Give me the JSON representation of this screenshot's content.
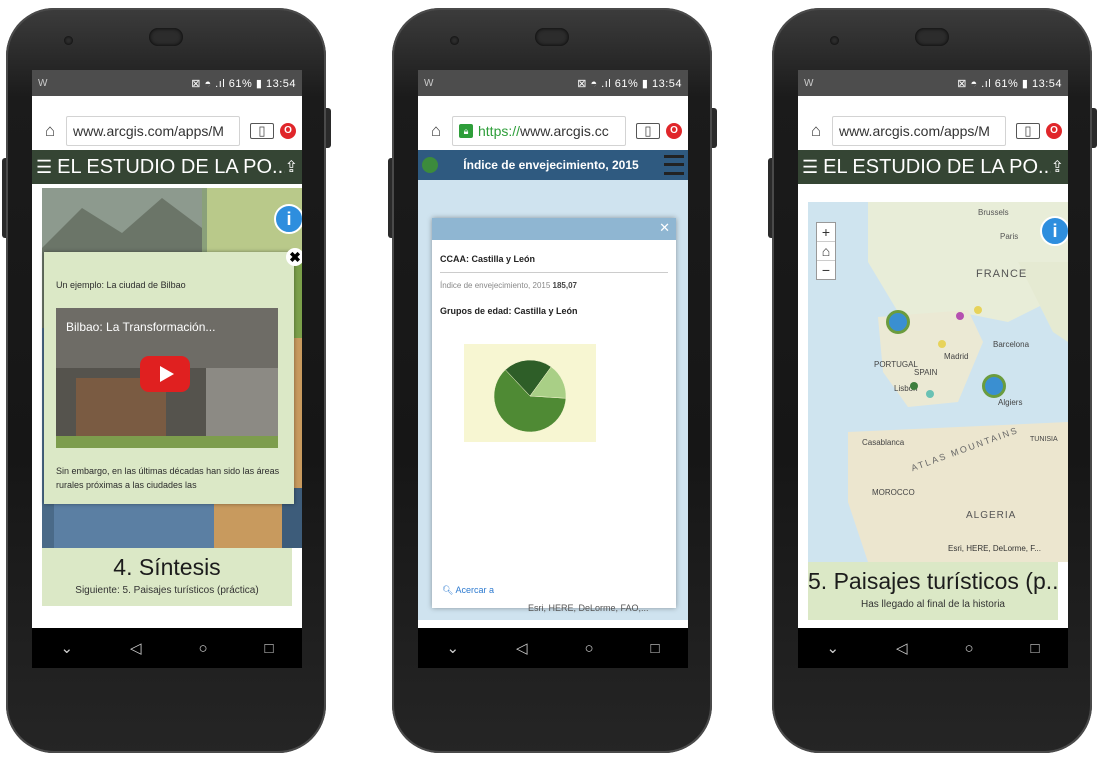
{
  "phones": [
    {
      "status": {
        "left": "W",
        "right": "⊠ ◓ .ıl 61% ▮ 13:54"
      },
      "url": "www.arcgis.com/apps/M",
      "header_title": "EL ESTUDIO DE LA PO...",
      "popup": {
        "intro": "Un ejemplo: La ciudad de Bilbao",
        "video_title": "Bilbao: La Transformación...",
        "body": "Sin embargo, en las últimas décadas han sido las áreas rurales próximas a las ciudades las"
      },
      "caption_title": "4. Síntesis",
      "caption_sub": "Siguiente: 5. Paisajes turísticos (práctica)"
    },
    {
      "status": {
        "left": "W",
        "right": "⊠ ◓ .ıl 61% ▮ 13:54"
      },
      "url_scheme": "https://",
      "url_host": "www.arcgis.cc",
      "header_title": "Índice de envejecimiento, 2015",
      "info": {
        "ccaa": "CCAA: Castilla y León",
        "index_label": "Índice de envejecimiento, 2015",
        "index_value": "185,07",
        "groups_title": "Grupos de edad: Castilla y León",
        "zoom_label": "Acercar a"
      },
      "attribution": "Esri, HERE, DeLorme, FAO,..."
    },
    {
      "status": {
        "left": "W",
        "right": "⊠ ◓ .ıl 61% ▮ 13:54"
      },
      "url": "www.arcgis.com/apps/M",
      "header_title": "EL ESTUDIO DE LA PO...",
      "map_labels": {
        "france": "FRANCE",
        "portugal": "PORTUGAL",
        "spain": "SPAIN",
        "madrid": "Madrid",
        "barcelona": "Barcelona",
        "lisbon": "Lisbon",
        "algiers": "Algiers",
        "casablanca": "Casablanca",
        "tunisia": "TUNISIA",
        "morocco": "MOROCCO",
        "algeria": "ALGERIA",
        "mountains": "ATLAS MOUNTAINS",
        "brussels": "Brussels",
        "paris": "Paris"
      },
      "attribution": "Esri, HERE, DeLorme, F...",
      "caption_title": "5. Paisajes turísticos (p...",
      "caption_sub": "Has llegado al final de la historia"
    }
  ],
  "chart_data": {
    "type": "pie",
    "title": "",
    "series": [
      {
        "values": [
          62,
          22,
          16
        ]
      }
    ]
  },
  "colors": {
    "header_green": "#354534",
    "caption_bg": "#dbe8c6",
    "map_header_blue": "#2f5a80",
    "info_blue": "#2e8ede"
  }
}
